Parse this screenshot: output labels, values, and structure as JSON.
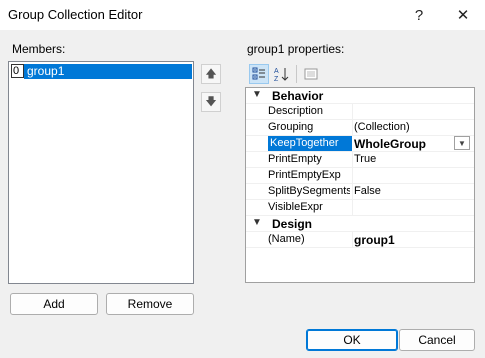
{
  "window": {
    "title": "Group Collection Editor",
    "help_glyph": "?",
    "close_glyph": "✕"
  },
  "members": {
    "label": "Members:",
    "items": [
      {
        "index": "0",
        "name": "group1"
      }
    ]
  },
  "move_up_glyph": "🡅",
  "move_down_glyph": "🡇",
  "buttons": {
    "add": "Add",
    "remove": "Remove",
    "ok": "OK",
    "cancel": "Cancel"
  },
  "properties": {
    "label": "group1 properties:",
    "categories": [
      {
        "name": "Behavior",
        "rows": [
          {
            "name": "Description",
            "value": ""
          },
          {
            "name": "Grouping",
            "value": "(Collection)"
          },
          {
            "name": "KeepTogether",
            "value": "WholeGroup",
            "selected": true
          },
          {
            "name": "PrintEmpty",
            "value": "True"
          },
          {
            "name": "PrintEmptyExp",
            "value": ""
          },
          {
            "name": "SplitBySegments",
            "value": "False"
          },
          {
            "name": "VisibleExpr",
            "value": ""
          }
        ]
      },
      {
        "name": "Design",
        "rows": [
          {
            "name": "(Name)",
            "value": "group1"
          }
        ]
      }
    ]
  }
}
